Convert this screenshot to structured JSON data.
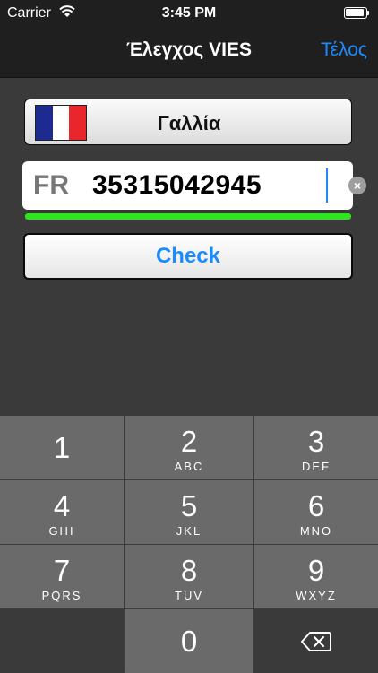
{
  "status_bar": {
    "carrier": "Carrier",
    "time": "3:45 PM"
  },
  "nav": {
    "title": "Έλεγχος VIES",
    "done_label": "Τέλος"
  },
  "country": {
    "name": "Γαλλία",
    "flag_colors": [
      "#1d2a8f",
      "#ffffff",
      "#e8262b"
    ]
  },
  "vat": {
    "prefix": "FR",
    "number": "35315042945"
  },
  "check_button": {
    "label": "Check"
  },
  "accent_colors": {
    "link": "#1a8cff",
    "valid": "#2ee51f"
  },
  "keypad": {
    "keys": [
      {
        "digit": "1",
        "letters": ""
      },
      {
        "digit": "2",
        "letters": "ABC"
      },
      {
        "digit": "3",
        "letters": "DEF"
      },
      {
        "digit": "4",
        "letters": "GHI"
      },
      {
        "digit": "5",
        "letters": "JKL"
      },
      {
        "digit": "6",
        "letters": "MNO"
      },
      {
        "digit": "7",
        "letters": "PQRS"
      },
      {
        "digit": "8",
        "letters": "TUV"
      },
      {
        "digit": "9",
        "letters": "WXYZ"
      },
      {
        "digit": "0",
        "letters": ""
      }
    ],
    "delete_icon": "backspace-icon"
  }
}
